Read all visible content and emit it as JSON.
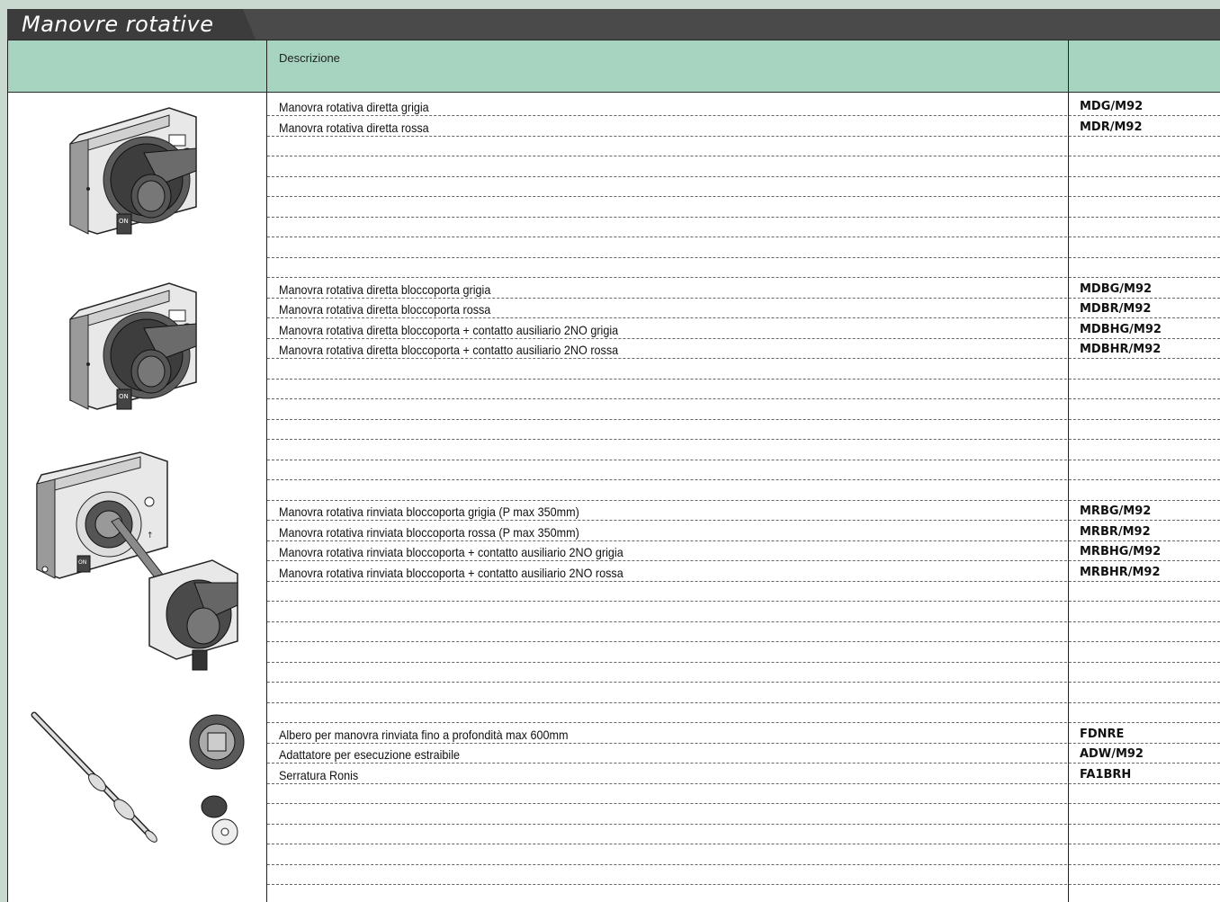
{
  "title": "Manovre rotative",
  "header": {
    "descrizione": "Descrizione",
    "codice": ""
  },
  "groups": [
    {
      "illustration": "direct-rotary-handle",
      "items": [
        {
          "desc": "Manovra rotativa diretta grigia",
          "code": "MDG/M92"
        },
        {
          "desc": "Manovra rotativa diretta rossa",
          "code": "MDR/M92"
        }
      ]
    },
    {
      "illustration": "direct-rotary-handle-door-lock",
      "items": [
        {
          "desc": "Manovra rotativa diretta bloccoporta grigia",
          "code": "MDBG/M92"
        },
        {
          "desc": "Manovra rotativa diretta bloccoporta rossa",
          "code": "MDBR/M92"
        },
        {
          "desc": "Manovra rotativa diretta bloccoporta + contatto ausiliario 2NO grigia",
          "code": "MDBHG/M92"
        },
        {
          "desc": "Manovra rotativa diretta bloccoporta + contatto ausiliario 2NO rossa",
          "code": "MDBHR/M92"
        }
      ]
    },
    {
      "illustration": "extended-rotary-handle",
      "items": [
        {
          "desc": "Manovra rotativa rinviata bloccoporta grigia (P max 350mm)",
          "code": "MRBG/M92"
        },
        {
          "desc": "Manovra rotativa rinviata bloccoporta rossa  (P max 350mm)",
          "code": "MRBR/M92"
        },
        {
          "desc": "Manovra rotativa rinviata bloccoporta + contatto ausiliario 2NO grigia",
          "code": "MRBHG/M92"
        },
        {
          "desc": "Manovra rotativa rinviata bloccoporta + contatto ausiliario 2NO rossa",
          "code": "MRBHR/M92"
        }
      ]
    },
    {
      "illustration": "shaft-adapter-lock",
      "items": [
        {
          "desc": "Albero per manovra rinviata fino a profondità max 600mm",
          "code": "FDNRE"
        },
        {
          "desc": "Adattatore per esecuzione estraibile",
          "code": "ADW/M92"
        },
        {
          "desc": "Serratura Ronis",
          "code": "FA1BRH"
        }
      ]
    }
  ],
  "illustration_labels": {
    "on": "ON"
  },
  "colors": {
    "header": "#a7d3c1",
    "titlebar": "#4a4a4a",
    "background": "#c9d9cf"
  }
}
